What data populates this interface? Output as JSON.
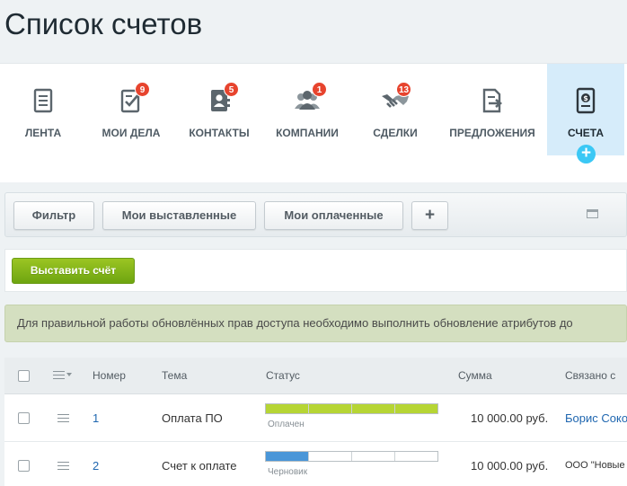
{
  "page": {
    "title": "Список счетов"
  },
  "tabs": [
    {
      "label": "ЛЕНТА",
      "badge": null,
      "icon": "feed-icon"
    },
    {
      "label": "МОИ ДЕЛА",
      "badge": "9",
      "icon": "checklist-icon"
    },
    {
      "label": "КОНТАКТЫ",
      "badge": "5",
      "icon": "contacts-book-icon"
    },
    {
      "label": "КОМПАНИИ",
      "badge": "1",
      "icon": "company-people-icon"
    },
    {
      "label": "СДЕЛКИ",
      "badge": "13",
      "icon": "handshake-icon"
    },
    {
      "label": "ПРЕДЛОЖЕНИЯ",
      "badge": null,
      "icon": "quote-export-icon"
    },
    {
      "label": "СЧЕТА",
      "badge": null,
      "icon": "invoice-icon",
      "active": true
    }
  ],
  "tab_add_symbol": "+",
  "filters": {
    "buttons": [
      "Фильтр",
      "Мои выставленные",
      "Мои оплаченные"
    ],
    "add_symbol": "+"
  },
  "toolbar": {
    "create_label": "Выставить счёт"
  },
  "notice": {
    "text": "Для правильной работы обновлённых прав доступа необходимо выполнить обновление атрибутов до"
  },
  "grid": {
    "columns": [
      "Номер",
      "Тема",
      "Статус",
      "Сумма",
      "Связано с"
    ],
    "rows": [
      {
        "number": "1",
        "topic": "Оплата ПО",
        "status": "Оплачен",
        "status_progress": 1.0,
        "status_color": "#b6d534",
        "amount": "10 000.00 руб.",
        "related": "Борис Соко",
        "related_is_link": true
      },
      {
        "number": "2",
        "topic": "Счет к оплате",
        "status": "Черновик",
        "status_progress": 0.25,
        "status_color": "#4a96d8",
        "amount": "10 000.00 руб.",
        "related": "ООО \"Новые",
        "related_is_link": false
      }
    ]
  },
  "colors": {
    "accent": "#3bc8f5",
    "badge": "#e7442e",
    "create_button": "#7fb21a",
    "notice_bg": "#d4dfc0"
  }
}
